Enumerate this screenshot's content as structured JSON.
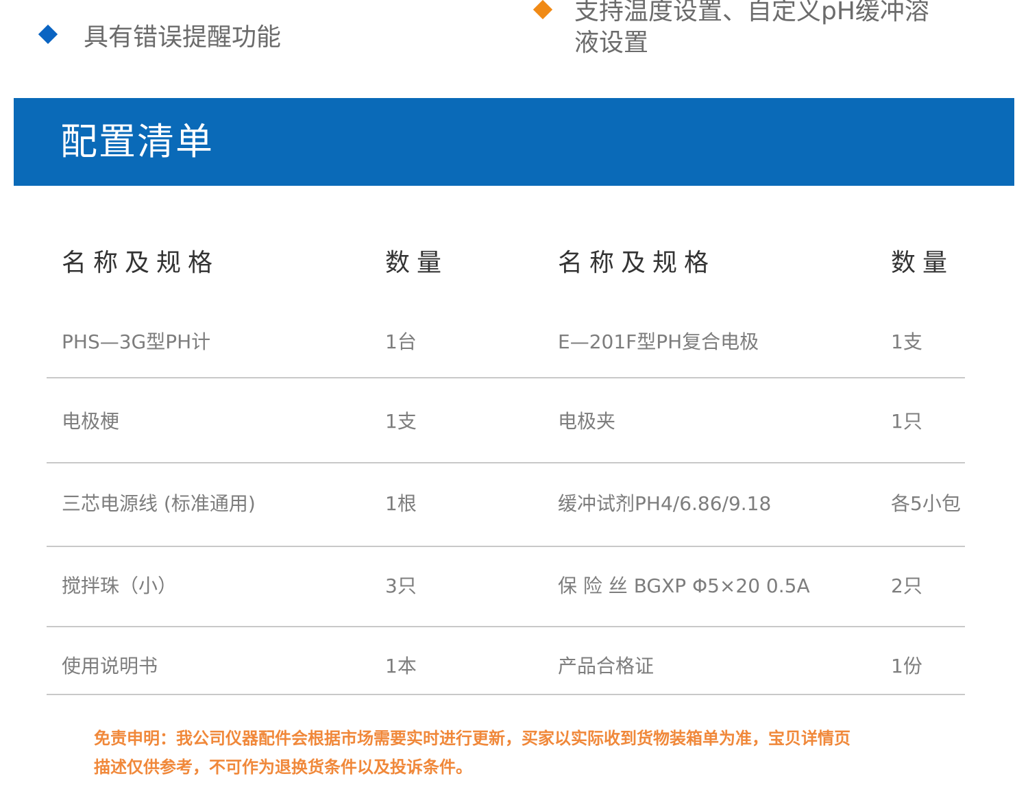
{
  "features": {
    "left_text": "具有错误提醒功能",
    "right_line1": "支持温度设置、自定义pH缓冲溶",
    "right_line2": "液设置",
    "left_color": "#0a64c2",
    "right_color": "#f08a16"
  },
  "band": {
    "title": "配置清单",
    "color": "#0a6ab8"
  },
  "table": {
    "headers": [
      "名称及规格",
      "数量",
      "名称及规格",
      "数量"
    ],
    "rows": [
      [
        "PHS—3G型PH计",
        "1台",
        "E—201F型PH复合电极",
        "1支"
      ],
      [
        "电极梗",
        "1支",
        "电极夹",
        "1只"
      ],
      [
        "三芯电源线 (标准通用)",
        "1根",
        "缓冲试剂PH4/6.86/9.18",
        "各5小包"
      ],
      [
        "搅拌珠（小）",
        "3只",
        "保 险 丝 BGXP Φ5×20 0.5A",
        "2只"
      ],
      [
        "使用说明书",
        "1本",
        "产品合格证",
        "1份"
      ]
    ]
  },
  "disclaimer": {
    "line1": "免责申明：我公司仪器配件会根据市场需要实时进行更新，买家以实际收到货物装箱单为准，宝贝详情页",
    "line2": "描述仅供参考，不可作为退换货条件以及投诉条件。",
    "color": "#f0883a"
  }
}
